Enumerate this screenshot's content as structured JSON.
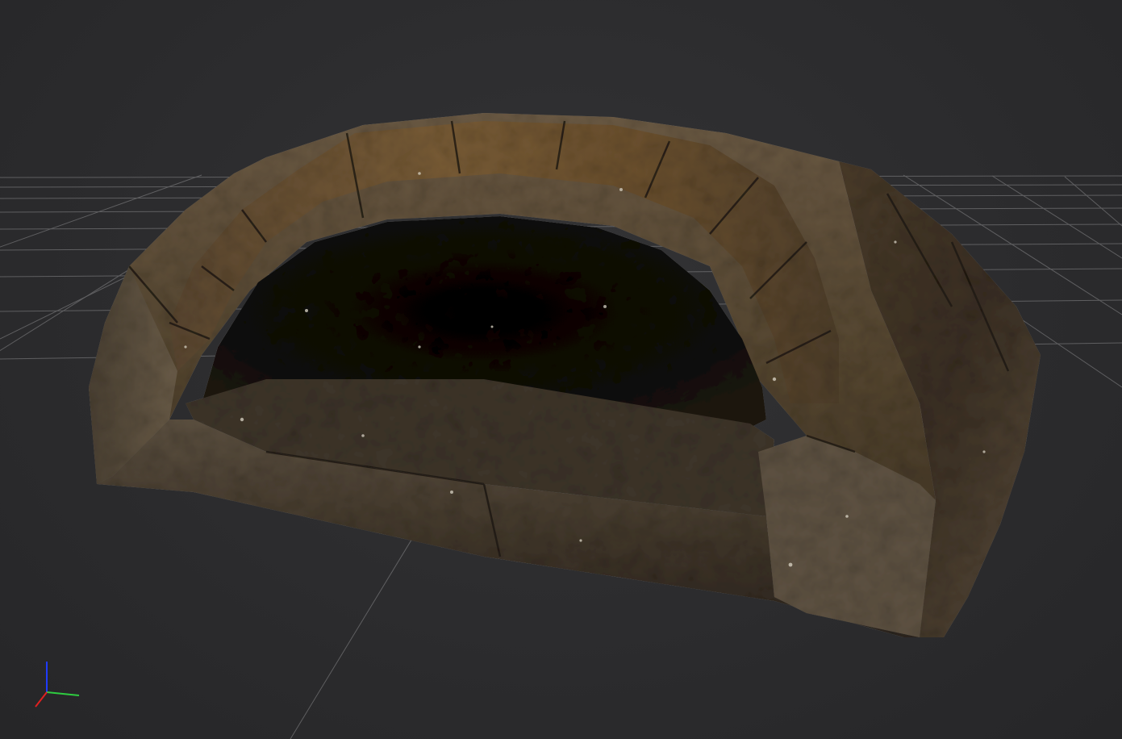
{
  "viewport": {
    "background_color": "#2b2b2d",
    "grid_color": "#8a8a8c",
    "view_mode": "3D perspective"
  },
  "model": {
    "kind": "stone arch alcove",
    "material_colors": {
      "stone_dark": "#2e261d",
      "stone_mid": "#5a4a36",
      "stone_light": "#8a7a64",
      "brick_ochre": "#6e5330",
      "interior": "#0b0907",
      "specular": "#e8e2d2"
    }
  },
  "axis_gizmo": {
    "x_color": "#2ecc40",
    "y_color": "#1f3bff",
    "z_color": "#e02020",
    "icon": "axis-triad-icon"
  }
}
